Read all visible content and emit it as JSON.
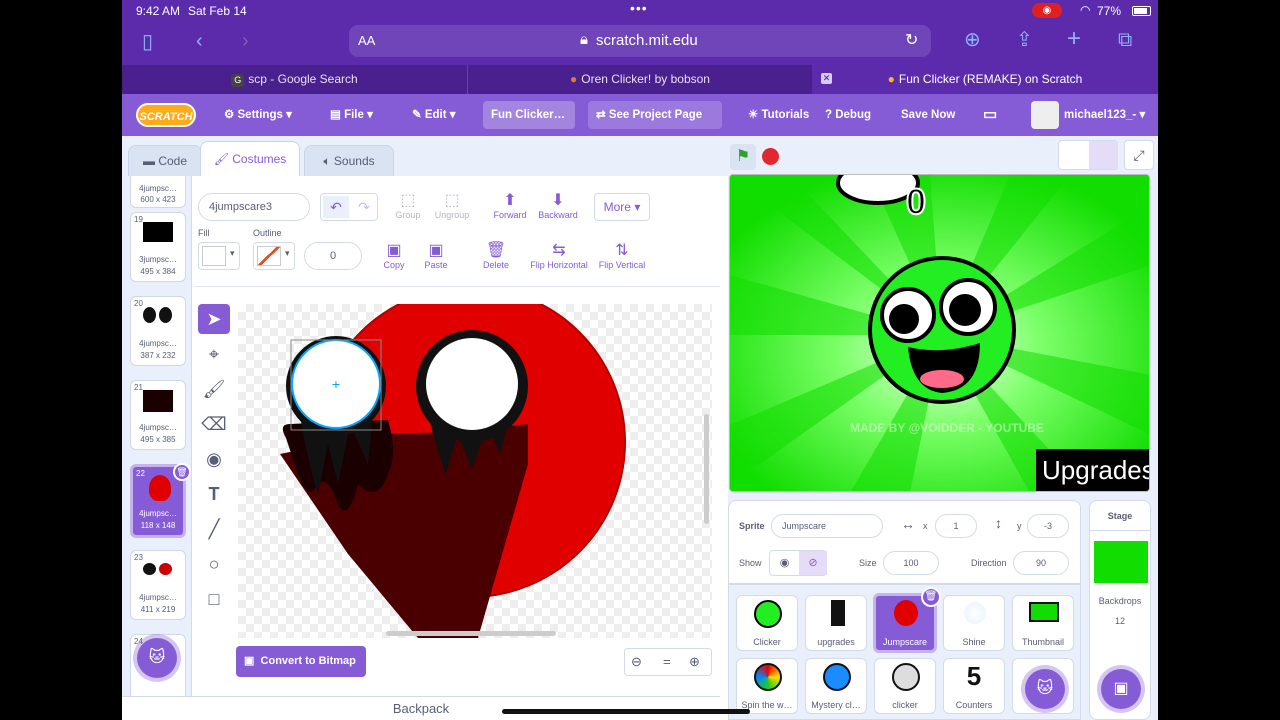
{
  "status": {
    "time": "9:42 AM",
    "date": "Sat Feb 14",
    "battery": "77%"
  },
  "browser": {
    "aa": "AA",
    "url": "scratch.mit.edu"
  },
  "tabs": [
    {
      "label": "scp - Google Search",
      "favicon": "G"
    },
    {
      "label": "Oren Clicker! by bobson"
    },
    {
      "label": "Fun Clicker (REMAKE) on Scratch"
    }
  ],
  "menu": {
    "logo": "SCRATCH",
    "settings": "Settings",
    "file": "File",
    "edit": "Edit",
    "project_title": "Fun Clicker…",
    "see_project": "See Project Page",
    "tutorials": "Tutorials",
    "debug": "Debug",
    "save": "Save Now",
    "user": "michael123_-"
  },
  "editor_tabs": {
    "code": "Code",
    "costumes": "Costumes",
    "sounds": "Sounds"
  },
  "costumes": [
    {
      "num": "",
      "name": "4jumpsc…",
      "size": "600 x 423"
    },
    {
      "num": "19",
      "name": "3jumpsc…",
      "size": "495 x 384"
    },
    {
      "num": "20",
      "name": "4jumpsc…",
      "size": "387 x 232"
    },
    {
      "num": "21",
      "name": "4jumpsc…",
      "size": "495 x 385"
    },
    {
      "num": "22",
      "name": "4jumpsc…",
      "size": "118 x 148"
    },
    {
      "num": "23",
      "name": "4jumpsc…",
      "size": "411 x 219"
    },
    {
      "num": "24",
      "name": "",
      "size": ""
    }
  ],
  "paint": {
    "costume_name": "4jumpscare3",
    "group": "Group",
    "ungroup": "Ungroup",
    "forward": "Forward",
    "backward": "Backward",
    "more": "More",
    "fill": "Fill",
    "outline": "Outline",
    "outline_width": "0",
    "copy": "Copy",
    "paste": "Paste",
    "delete": "Delete",
    "flip_h": "Flip Horizontal",
    "flip_v": "Flip Vertical",
    "convert": "Convert to Bitmap",
    "zoom_reset": "="
  },
  "backpack": "Backpack",
  "stage": {
    "counter": "0",
    "watermark": "MADE BY @VOIDDER - YOUTUBE",
    "upgrades": "Upgrades"
  },
  "sprite_info": {
    "sprite_label": "Sprite",
    "sprite_name": "Jumpscare",
    "x_label": "x",
    "x": "1",
    "y_label": "y",
    "y": "-3",
    "show_label": "Show",
    "size_label": "Size",
    "size": "100",
    "direction_label": "Direction",
    "direction": "90"
  },
  "sprites": [
    {
      "name": "Clicker"
    },
    {
      "name": "upgrades"
    },
    {
      "name": "Jumpscare"
    },
    {
      "name": "Shine"
    },
    {
      "name": "Thumbnail"
    },
    {
      "name": "Spin the w…"
    },
    {
      "name": "Mystery cl…"
    },
    {
      "name": "clicker"
    },
    {
      "name": "Counters",
      "glyph": "5"
    },
    {
      "name": ""
    }
  ],
  "stage_panel": {
    "title": "Stage",
    "backdrops_label": "Backdrops",
    "backdrops_count": "12"
  },
  "colors": {
    "accent": "#855cd6",
    "menu": "#855cd6",
    "browser": "#5c2bab",
    "stage_green": "#11dd00",
    "red": "#e10000"
  }
}
